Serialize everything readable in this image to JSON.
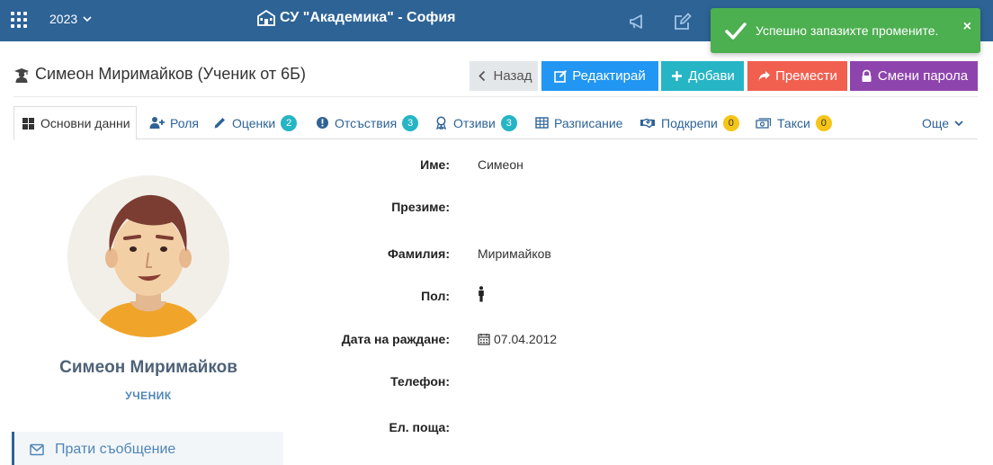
{
  "topbar": {
    "year": "2023",
    "school": "СУ \"Академика\" - София"
  },
  "toast": {
    "message": "Успешно запазихте промените.",
    "close": "×"
  },
  "header": {
    "title": "Симеон Миримайков (Ученик от 6Б)",
    "buttons": {
      "back": "Назад",
      "edit": "Редактирай",
      "add": "Добави",
      "move": "Премести",
      "password": "Смени парола"
    }
  },
  "tabs": [
    {
      "label": "Основни данни"
    },
    {
      "label": "Роля"
    },
    {
      "label": "Оценки",
      "badge": "2"
    },
    {
      "label": "Отсъствия",
      "badge": "3"
    },
    {
      "label": "Отзиви",
      "badge": "3"
    },
    {
      "label": "Разписание"
    },
    {
      "label": "Подкрепи",
      "badge": "0"
    },
    {
      "label": "Такси",
      "badge": "0"
    },
    {
      "label": "Още"
    }
  ],
  "profile": {
    "name": "Симеон Миримайков",
    "role": "УЧЕНИК",
    "send_message": "Прати съобщение"
  },
  "fields": {
    "first_name": {
      "label": "Име:",
      "value": "Симеон"
    },
    "middle_name": {
      "label": "Презиме:",
      "value": ""
    },
    "last_name": {
      "label": "Фамилия:",
      "value": "Миримайков"
    },
    "gender": {
      "label": "Пол:",
      "icon": "male-icon"
    },
    "birth_date": {
      "label": "Дата на раждане:",
      "value": "07.04.2012"
    },
    "phone": {
      "label": "Телефон:",
      "value": ""
    },
    "email": {
      "label": "Ел. поща:",
      "value": ""
    }
  },
  "colors": {
    "topbar": "#2e6396",
    "toast": "#4caf50",
    "edit": "#2196f3",
    "add": "#26b5c5",
    "move": "#f15f4f",
    "password": "#8e44ad"
  }
}
